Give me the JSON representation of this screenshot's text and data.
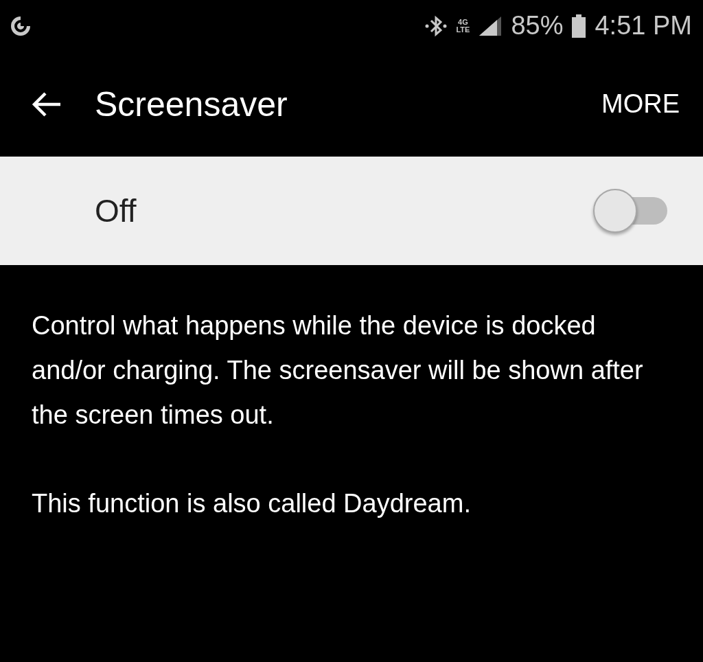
{
  "status_bar": {
    "network_top": "4G",
    "network_bottom": "LTE",
    "battery": "85%",
    "time": "4:51 PM"
  },
  "header": {
    "title": "Screensaver",
    "action": "MORE"
  },
  "master_switch": {
    "label": "Off",
    "on": false
  },
  "description": [
    "Control what happens while the device is docked and/or charging. The screensaver will be shown after the screen times out.",
    "This function is also called Daydream."
  ]
}
